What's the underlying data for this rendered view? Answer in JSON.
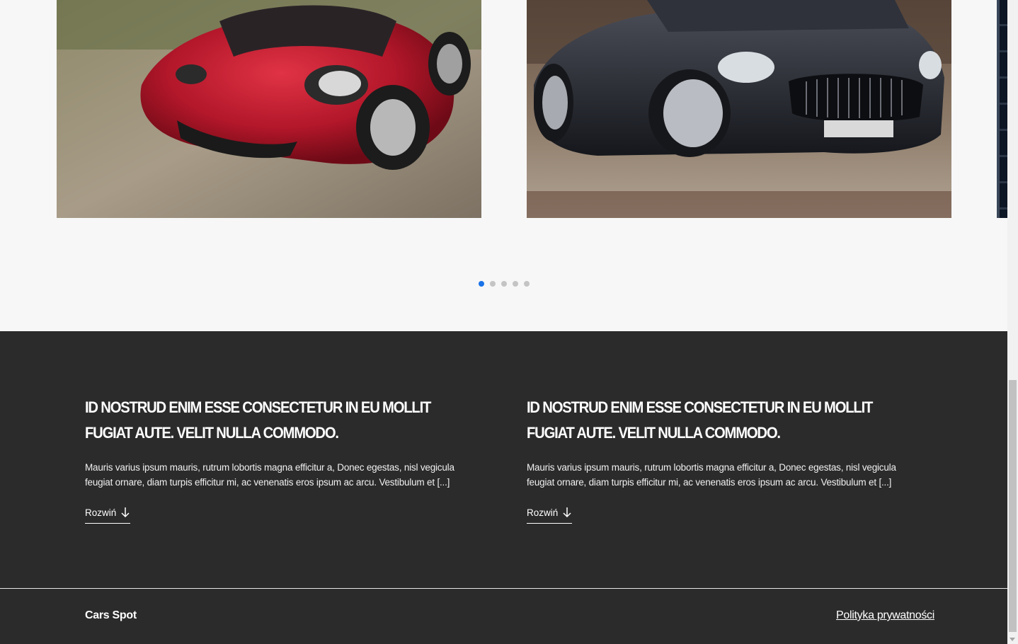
{
  "carousel": {
    "slides": [
      {
        "alt": "red sports car",
        "accent": "#b0182a"
      },
      {
        "alt": "black convertible",
        "accent": "#1e2026"
      },
      {
        "alt": "dark interior"
      }
    ],
    "dots": 5,
    "active_dot": 0,
    "active_color": "#1a73e8"
  },
  "articles": [
    {
      "title": "Id nostrud enim esse consectetur in eu mollit fugiat aute. Velit nulla commodo.",
      "body": "Mauris varius ipsum mauris, rutrum lobortis magna efficitur a, Donec egestas, nisl vegicula feugiat ornare, diam turpis efficitur mi, ac venenatis eros ipsum ac arcu. Vestibulum et [...]",
      "expand_label": "Rozwiń",
      "expand_icon": "arrow-down-icon"
    },
    {
      "title": "Id nostrud enim esse consectetur in eu mollit fugiat aute. Velit nulla commodo.",
      "body": "Mauris varius ipsum mauris, rutrum lobortis magna efficitur a, Donec egestas, nisl vegicula feugiat ornare, diam turpis efficitur mi, ac venenatis eros ipsum ac arcu. Vestibulum et [...]",
      "expand_label": "Rozwiń",
      "expand_icon": "arrow-down-icon"
    }
  ],
  "footer": {
    "brand": "Cars Spot",
    "privacy_link": "Polityka prywatności"
  },
  "colors": {
    "dark_section": "#2b2b2b",
    "page_background": "#f7f7f7"
  }
}
